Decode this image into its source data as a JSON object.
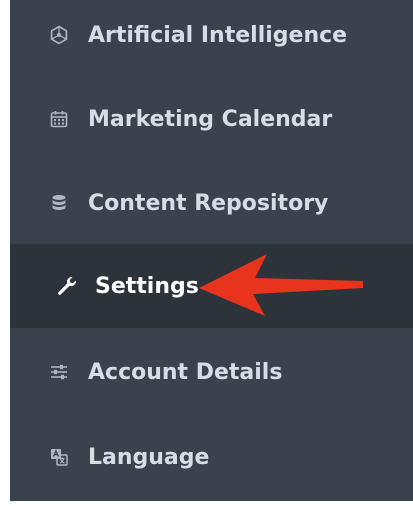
{
  "sidebar": {
    "items": [
      {
        "label": "Artificial Intelligence",
        "icon": "hexagon-network-icon"
      },
      {
        "label": "Marketing Calendar",
        "icon": "calendar-icon"
      },
      {
        "label": "Content Repository",
        "icon": "database-icon"
      },
      {
        "label": "Settings",
        "icon": "wrench-icon",
        "active": true
      },
      {
        "label": "Account Details",
        "icon": "sliders-icon"
      },
      {
        "label": "Language",
        "icon": "translate-icon"
      }
    ]
  },
  "colors": {
    "sidebar_bg": "#3a434d",
    "active_bg": "#2c333a",
    "text": "#d6dde4",
    "active_text": "#ffffff",
    "annotation_arrow": "#e8341c"
  }
}
